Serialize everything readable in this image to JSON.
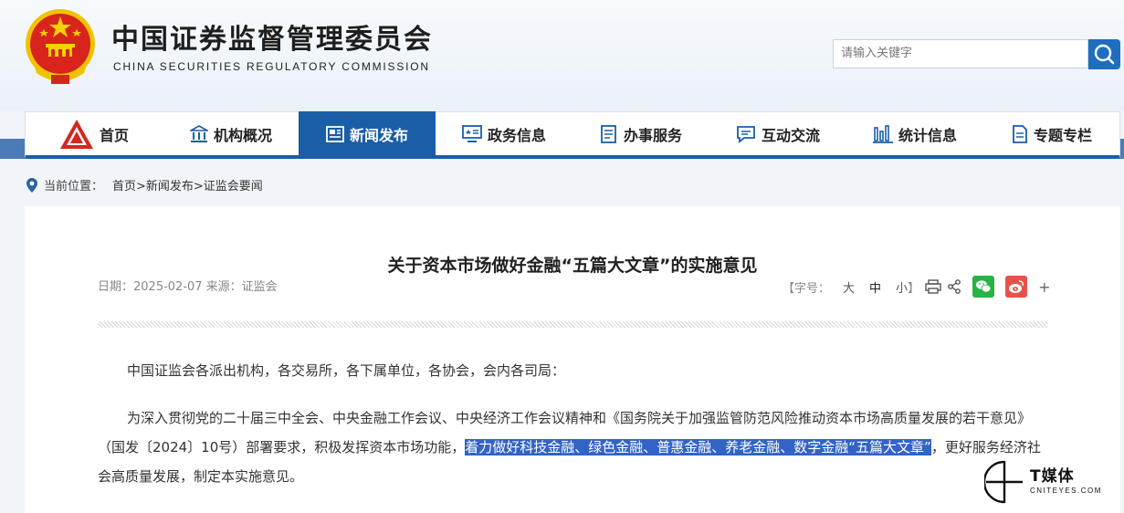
{
  "header": {
    "title_cn": "中国证券监督管理委员会",
    "title_en": "CHINA SECURITIES REGULATORY COMMISSION",
    "search_placeholder": "请输入关键字",
    "emblem_icon": "national-emblem-icon"
  },
  "nav": {
    "items": [
      {
        "label": "首页",
        "icon": "csrc-logo-icon"
      },
      {
        "label": "机构概况",
        "icon": "building-icon"
      },
      {
        "label": "新闻发布",
        "icon": "newspaper-icon",
        "active": true
      },
      {
        "label": "政务信息",
        "icon": "monitor-icon"
      },
      {
        "label": "办事服务",
        "icon": "document-list-icon"
      },
      {
        "label": "互动交流",
        "icon": "chat-icon"
      },
      {
        "label": "统计信息",
        "icon": "bar-chart-icon"
      },
      {
        "label": "专题专栏",
        "icon": "file-icon"
      }
    ],
    "active_color": "#1a5ea8"
  },
  "breadcrumb": {
    "label": "当前位置：",
    "path": "首页>新闻发布>证监会要闻"
  },
  "article": {
    "title": "关于资本市场做好金融“五篇大文章”的实施意见",
    "meta": "日期：2025-02-07  来源：证监会",
    "font_size_label": "【字号：",
    "font_sizes": [
      "大",
      "中",
      "小"
    ],
    "font_size_close": "】",
    "share_more": "+",
    "para1": "中国证监会各派出机构，各交易所，各下属单位，各协会，会内各司局：",
    "para2_before": "为深入贯彻党的二十届三中全会、中央金融工作会议、中央经济工作会议精神和《国务院关于加强监管防范风险推动资本市场高质量发展的若干意见》（国发〔2024〕10号）部署要求，积极发挥资本市场功能，",
    "para2_highlight": "着力做好科技金融、绿色金融、普惠金融、养老金融、数字金融“五篇大文章”",
    "para2_after": "，更好服务经济社会高质量发展，制定本实施意见。"
  },
  "watermark": {
    "main": "T媒体",
    "sub": "CNITEYES.COM"
  },
  "colors": {
    "wechat": "#27b245",
    "weibo": "#e6524b",
    "highlight": "#3263c6"
  }
}
